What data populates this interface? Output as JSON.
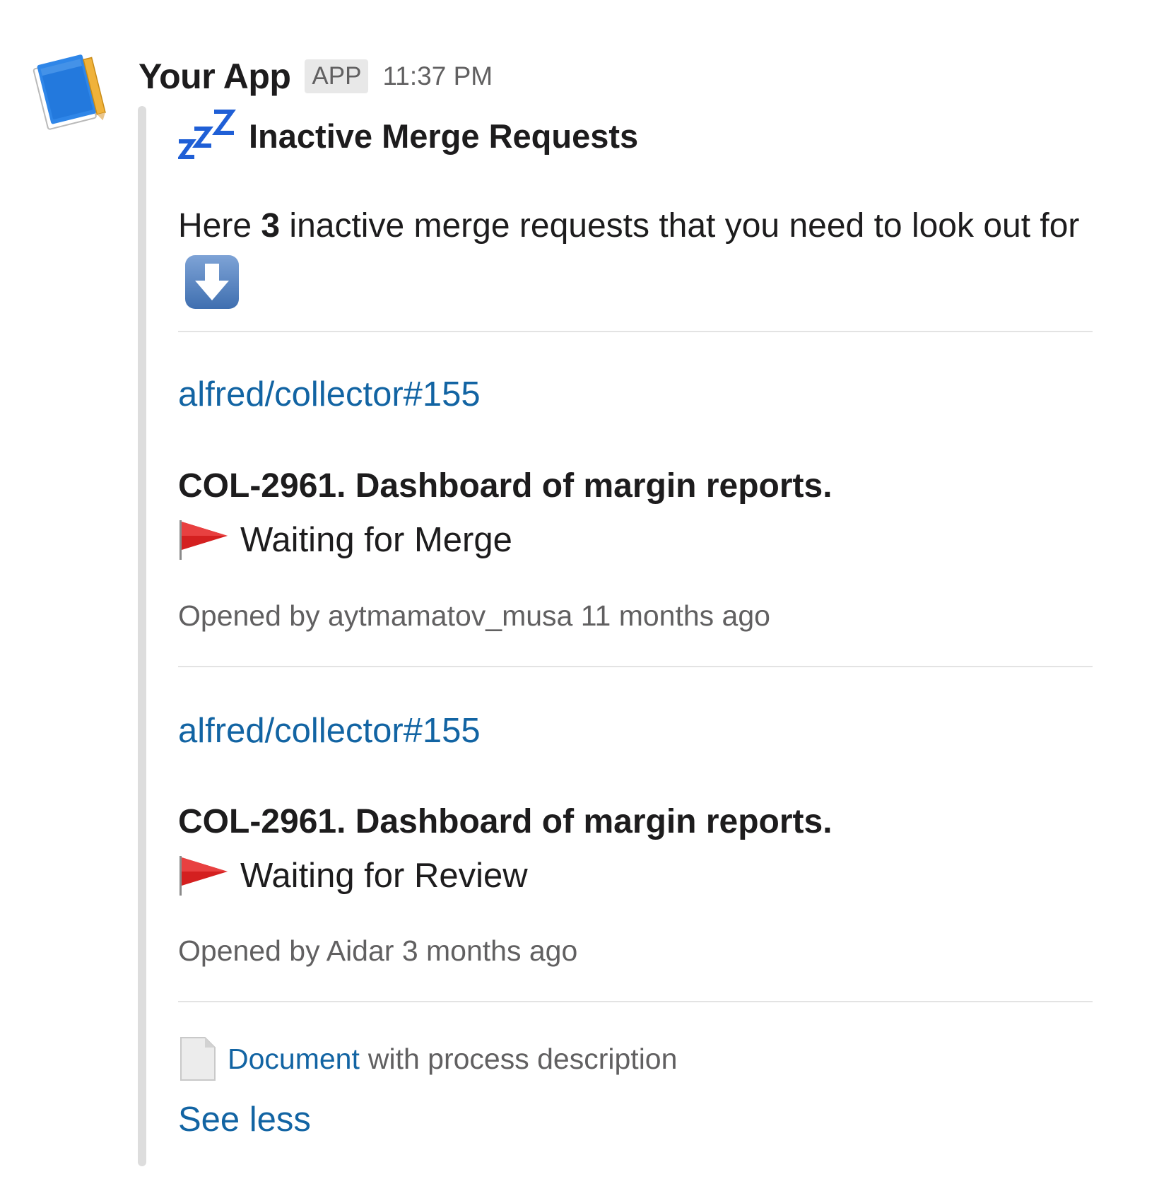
{
  "message": {
    "app_name": "Your App",
    "badge": "APP",
    "timestamp": "11:37 PM",
    "avatar_icon": "notebook-pencil-icon"
  },
  "content": {
    "header_icon": "zzz-sleeping-icon",
    "title": "Inactive Merge Requests",
    "intro": {
      "prefix": "Here ",
      "count": "3",
      "suffix": " inactive merge requests that you need to look out for",
      "icon": "down-arrow-icon"
    },
    "merge_requests": [
      {
        "link": "alfred/collector#155",
        "title": "COL-2961. Dashboard of margin reports.",
        "status_icon": "red-flag-icon",
        "status": "Waiting for Merge",
        "meta": "Opened by aytmamatov_musa 11 months ago"
      },
      {
        "link": "alfred/collector#155",
        "title": "COL-2961. Dashboard of margin reports.",
        "status_icon": "red-flag-icon",
        "status": "Waiting for Review",
        "meta": "Opened by Aidar 3 months ago"
      }
    ],
    "document": {
      "icon": "document-page-icon",
      "link_text": "Document",
      "rest_text": "with process description"
    },
    "see_less": "See less"
  },
  "colors": {
    "link": "#1264a3",
    "text": "#1d1c1d",
    "muted": "#616061",
    "badge_bg": "#e8e8e8",
    "attachment_bar": "#dddddd",
    "divider": "#e3e3e3",
    "flag": "#d42020",
    "zzz": "#1f5fd6"
  }
}
